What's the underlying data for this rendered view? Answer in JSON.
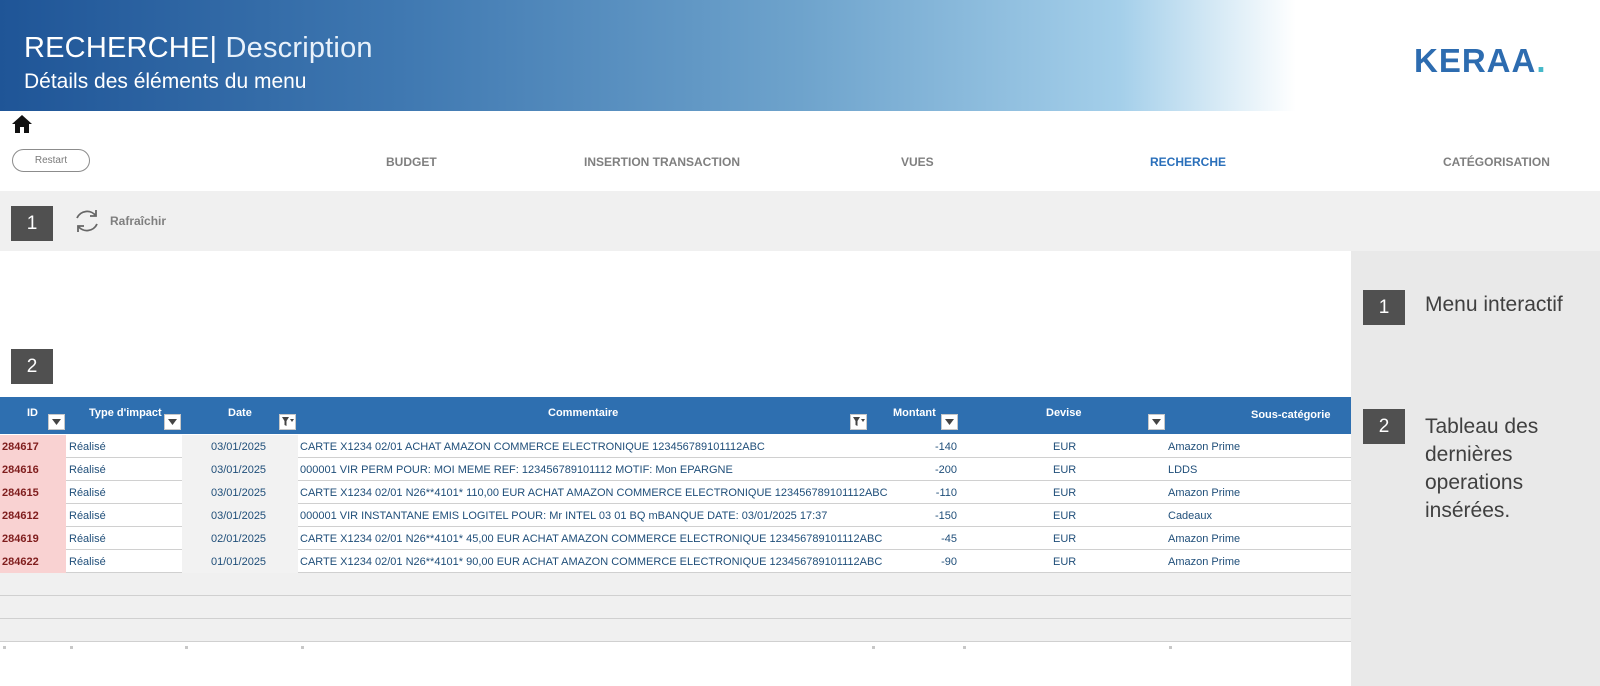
{
  "header": {
    "title_main": "RECHERCHE|",
    "title_desc": " Description",
    "subtitle": "Détails des éléments du menu",
    "logo_text": "KERAA",
    "logo_dot": "."
  },
  "nav": {
    "restart_label": "Restart",
    "tabs": [
      {
        "label": "BUDGET",
        "active": false
      },
      {
        "label": "INSERTION TRANSACTION",
        "active": false
      },
      {
        "label": "VUES",
        "active": false
      },
      {
        "label": "RECHERCHE",
        "active": true
      },
      {
        "label": "CATÉGORISATION",
        "active": false
      }
    ]
  },
  "toolbar": {
    "badge": "1",
    "refresh_label": "Rafraîchir"
  },
  "table_section": {
    "badge": "2"
  },
  "side_panel": {
    "items": [
      {
        "badge": "1",
        "text": "Menu interactif"
      },
      {
        "badge": "2",
        "text": "Tableau des dernières operations insérées."
      }
    ]
  },
  "table": {
    "columns": [
      "ID",
      "Type d'impact",
      "Date",
      "Commentaire",
      "Montant",
      "Devise",
      "Sous-catégorie"
    ],
    "rows": [
      {
        "id": "284617",
        "type": "Réalisé",
        "date": "03/01/2025",
        "comment": "CARTE X1234 02/01 ACHAT AMAZON COMMERCE ELECTRONIQUE 123456789101112ABC",
        "amount": "-140",
        "currency": "EUR",
        "subcat": "Amazon Prime"
      },
      {
        "id": "284616",
        "type": "Réalisé",
        "date": "03/01/2025",
        "comment": "000001 VIR PERM POUR: MOI MEME REF: 123456789101112 MOTIF: Mon EPARGNE",
        "amount": "-200",
        "currency": "EUR",
        "subcat": "LDDS"
      },
      {
        "id": "284615",
        "type": "Réalisé",
        "date": "03/01/2025",
        "comment": "CARTE X1234 02/01 N26**4101* 110,00  EUR ACHAT AMAZON COMMERCE ELECTRONIQUE 123456789101112ABC",
        "amount": "-110",
        "currency": "EUR",
        "subcat": "Amazon Prime"
      },
      {
        "id": "284612",
        "type": "Réalisé",
        "date": "03/01/2025",
        "comment": "000001 VIR INSTANTANE EMIS LOGITEL POUR: Mr INTEL 03 01 BQ mBANQUE DATE: 03/01/2025 17:37",
        "amount": "-150",
        "currency": "EUR",
        "subcat": "Cadeaux"
      },
      {
        "id": "284619",
        "type": "Réalisé",
        "date": "02/01/2025",
        "comment": "CARTE X1234 02/01 N26**4101* 45,00  EUR ACHAT AMAZON COMMERCE ELECTRONIQUE 123456789101112ABC",
        "amount": "-45",
        "currency": "EUR",
        "subcat": "Amazon Prime"
      },
      {
        "id": "284622",
        "type": "Réalisé",
        "date": "01/01/2025",
        "comment": "CARTE X1234 02/01 N26**4101* 90,00  EUR ACHAT AMAZON COMMERCE ELECTRONIQUE 123456789101112ABC",
        "amount": "-90",
        "currency": "EUR",
        "subcat": "Amazon Prime"
      }
    ]
  },
  "colors": {
    "accent": "#2e6fb0",
    "active_tab": "#2a6fba",
    "badge": "#505050",
    "id_cell": "#f9d2d2"
  },
  "icons": [
    "home-icon",
    "refresh-icon",
    "filter-dropdown-icon",
    "filter-active-icon"
  ]
}
